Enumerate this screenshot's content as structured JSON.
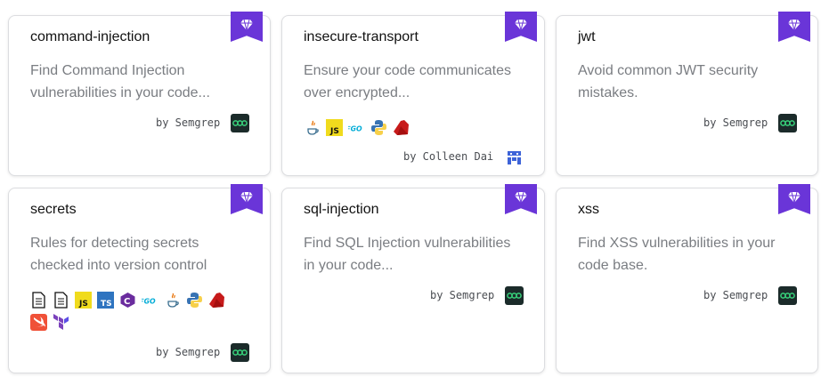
{
  "colors": {
    "accent": "#6a35d8",
    "semgrep": "#1b2b2a",
    "semgrep_ring": "#37d07a",
    "author_avatar": "#3d63d8"
  },
  "cards": [
    {
      "title": "command-injection",
      "description": "Find Command Injection vulnerabilities in your code...",
      "author": "by Semgrep",
      "avatar_icon": "semgrep-logo-icon",
      "languages": []
    },
    {
      "title": "insecure-transport",
      "description": "Ensure your code communicates over encrypted...",
      "author": "by Colleen Dai",
      "avatar_icon": "user-avatar-icon",
      "languages": [
        "java-icon",
        "javascript-icon",
        "go-icon",
        "python-icon",
        "ruby-icon"
      ]
    },
    {
      "title": "jwt",
      "description": "Avoid common JWT security mistakes.",
      "author": "by Semgrep",
      "avatar_icon": "semgrep-logo-icon",
      "languages": []
    },
    {
      "title": "secrets",
      "description": "Rules for detecting secrets checked into version control",
      "author": "by Semgrep",
      "avatar_icon": "semgrep-logo-icon",
      "languages": [
        "generic-file-icon",
        "generic-file-icon",
        "javascript-icon",
        "typescript-icon",
        "csharp-icon",
        "go-icon",
        "java-icon",
        "python-icon",
        "ruby-icon",
        "swift-icon",
        "terraform-icon"
      ]
    },
    {
      "title": "sql-injection",
      "description": "Find SQL Injection vulnerabilities in your code...",
      "author": "by Semgrep",
      "avatar_icon": "semgrep-logo-icon",
      "languages": []
    },
    {
      "title": "xss",
      "description": "Find XSS vulnerabilities in your code base.",
      "author": "by Semgrep",
      "avatar_icon": "semgrep-logo-icon",
      "languages": []
    }
  ]
}
